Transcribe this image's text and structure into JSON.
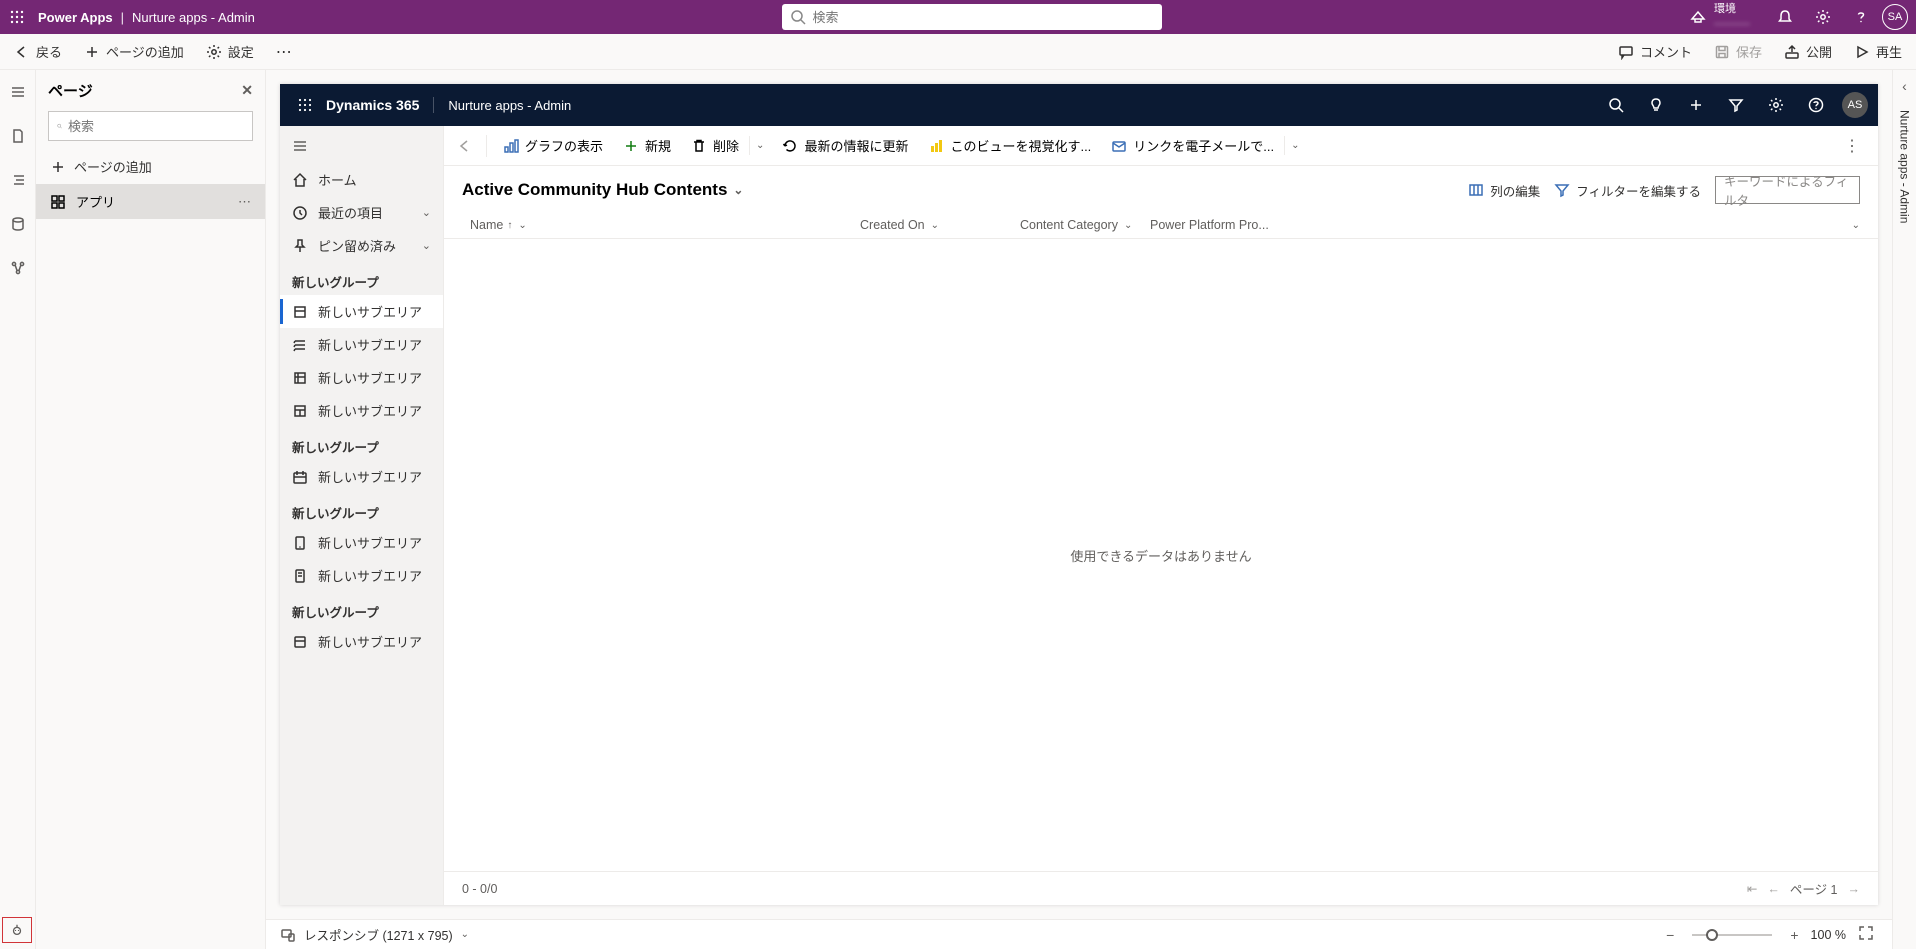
{
  "top_header": {
    "app": "Power Apps",
    "sep": "|",
    "project": "Nurture apps - Admin",
    "search_placeholder": "検索",
    "env_label": "環境",
    "env_name": "———",
    "avatar": "SA"
  },
  "cmd_bar": {
    "back": "戻る",
    "add_page": "ページの追加",
    "settings": "設定",
    "comments": "コメント",
    "save": "保存",
    "publish": "公開",
    "play": "再生"
  },
  "pages_panel": {
    "title": "ページ",
    "search_placeholder": "検索",
    "add_page": "ページの追加",
    "item_label": "アプリ"
  },
  "d365_header": {
    "title": "Dynamics 365",
    "app": "Nurture apps - Admin",
    "avatar": "AS"
  },
  "d365_nav": {
    "home": "ホーム",
    "recent": "最近の項目",
    "pinned": "ピン留め済み",
    "groups": [
      {
        "label": "新しいグループ",
        "items": [
          "新しいサブエリア",
          "新しいサブエリア",
          "新しいサブエリア",
          "新しいサブエリア"
        ]
      },
      {
        "label": "新しいグループ",
        "items": [
          "新しいサブエリア"
        ]
      },
      {
        "label": "新しいグループ",
        "items": [
          "新しいサブエリア",
          "新しいサブエリア"
        ]
      },
      {
        "label": "新しいグループ",
        "items": [
          "新しいサブエリア"
        ]
      }
    ]
  },
  "d365_cmdbar": {
    "show_chart": "グラフの表示",
    "new": "新規",
    "delete": "削除",
    "refresh": "最新の情報に更新",
    "visualize": "このビューを視覚化す...",
    "email_link": "リンクを電子メールで..."
  },
  "view": {
    "title": "Active Community Hub Contents",
    "edit_columns": "列の編集",
    "edit_filters": "フィルターを編集する",
    "filter_placeholder": "キーワードによるフィルタ"
  },
  "grid": {
    "columns": {
      "name": "Name",
      "created": "Created On",
      "category": "Content Category",
      "ppp": "Power Platform Pro..."
    },
    "empty": "使用できるデータはありません",
    "footer_count": "0 - 0/0",
    "page": "ページ 1"
  },
  "canvas_status": {
    "responsive": "レスポンシブ (1271 x 795)",
    "zoom": "100 %"
  },
  "right_label": "Nurture apps - Admin"
}
